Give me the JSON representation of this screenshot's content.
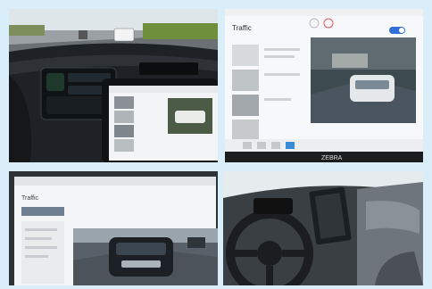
{
  "panels": {
    "top_left": {
      "subject": "car-dashboard-tablet-road-view"
    },
    "top_right": {
      "subject": "laptop-screen-traffic-app",
      "app_title": "Traffic",
      "brand": "ZEBRA"
    },
    "bottom_left": {
      "subject": "laptop-screen-traffic-app-camera-feed",
      "app_title": "Traffic"
    },
    "bottom_right": {
      "subject": "car-interior-steering-wheel-mounted-tablet"
    }
  },
  "colors": {
    "background": "#d9eef8",
    "screen_white": "#f3f4f6",
    "dash_dark": "#1e2226",
    "sky": "#dfe6ea",
    "accent_blue": "#2f6fd6",
    "green": "#6f8f3c"
  }
}
